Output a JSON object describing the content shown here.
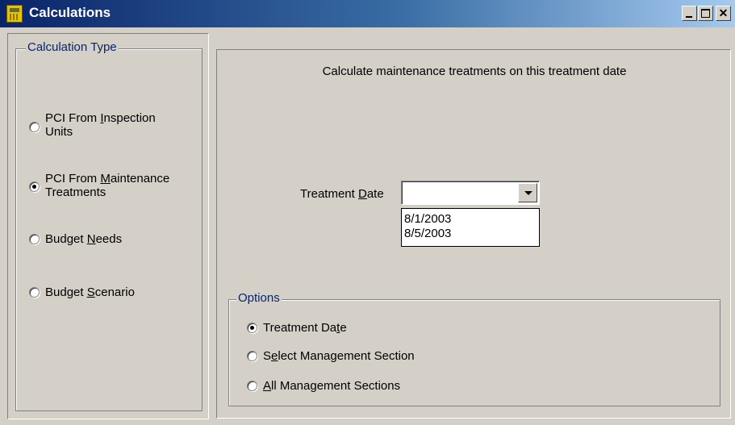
{
  "window": {
    "title": "Calculations",
    "controls": [
      "minimize",
      "maximize",
      "close"
    ],
    "icon": "calculator-icon"
  },
  "calculation_type": {
    "legend": "Calculation Type",
    "options": [
      {
        "pre": "PCI From ",
        "accel": "I",
        "post": "nspection",
        "line2": "Units",
        "selected": false
      },
      {
        "pre": "PCI From ",
        "accel": "M",
        "post": "aintenance",
        "line2": "Treatments",
        "selected": true
      },
      {
        "pre": "Budget ",
        "accel": "N",
        "post": "eeds",
        "line2": "",
        "selected": false
      },
      {
        "pre": "Budget ",
        "accel": "S",
        "post": "cenario",
        "line2": "",
        "selected": false
      }
    ]
  },
  "main": {
    "heading": "Calculate maintenance treatments on this treatment date",
    "treatment_date": {
      "label_pre": "Treatment ",
      "label_accel": "D",
      "label_post": "ate",
      "value": "",
      "dropdown_items": [
        "8/1/2003",
        "8/5/2003"
      ]
    }
  },
  "options": {
    "legend": "Options",
    "items": [
      {
        "pre": "Treatment Da",
        "accel": "t",
        "post": "e",
        "selected": true
      },
      {
        "pre": "S",
        "accel": "e",
        "post": "lect Management Section",
        "selected": false
      },
      {
        "pre": "",
        "accel": "A",
        "post": "ll Management Sections",
        "selected": false
      }
    ]
  }
}
